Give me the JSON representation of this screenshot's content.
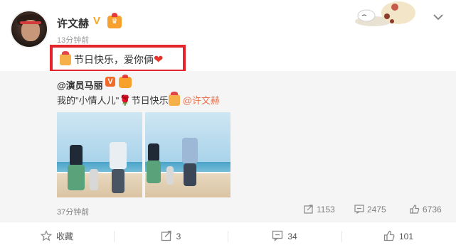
{
  "post": {
    "username": "许文赫",
    "timestamp": "13分钟前",
    "text_main": "节日快乐，爱你俩",
    "icons": {
      "verified": "verified-v-icon",
      "member": "member-crown-icon",
      "gift": "gift-icon",
      "heart": "heart-icon",
      "menu": "chevron-down-icon"
    },
    "highlight_color": "#e4262c"
  },
  "repost": {
    "username": "@演员马丽",
    "text_prefix": "我的\"小情人儿\"",
    "text_middle": "节日快乐",
    "mention": "@许文赫",
    "time": "37分钟前",
    "stats": {
      "reposts": "1153",
      "comments": "2475",
      "likes": "6736"
    }
  },
  "actions": {
    "favorite": "收藏",
    "repost": "3",
    "comment": "34",
    "like": "101"
  },
  "colors": {
    "mention": "#eb7350",
    "repost_bg": "#f5f5f5",
    "verified_orange": "#f5a623"
  }
}
